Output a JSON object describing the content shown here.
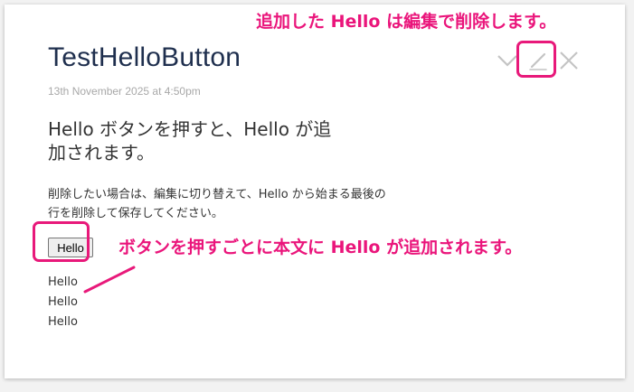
{
  "card": {
    "title": "TestHelloButton",
    "timestamp": "13th November 2025 at 4:50pm",
    "heading": "Hello ボタンを押すと、Hello が追加されます。",
    "description": "削除したい場合は、編集に切り替えて、Hello から始まる最後の行を削除して保存してください。",
    "button_label": "Hello",
    "hello_lines": [
      "Hello",
      "Hello",
      "Hello"
    ]
  },
  "toolbar": {
    "icons": [
      "chevron-down-icon",
      "edit-icon",
      "close-icon"
    ]
  },
  "annotations": {
    "top_note": "追加した Hello は編集で削除します。",
    "button_note": "ボタンを押すごとに本文に Hello が追加されます。",
    "color": "#e8197a"
  }
}
